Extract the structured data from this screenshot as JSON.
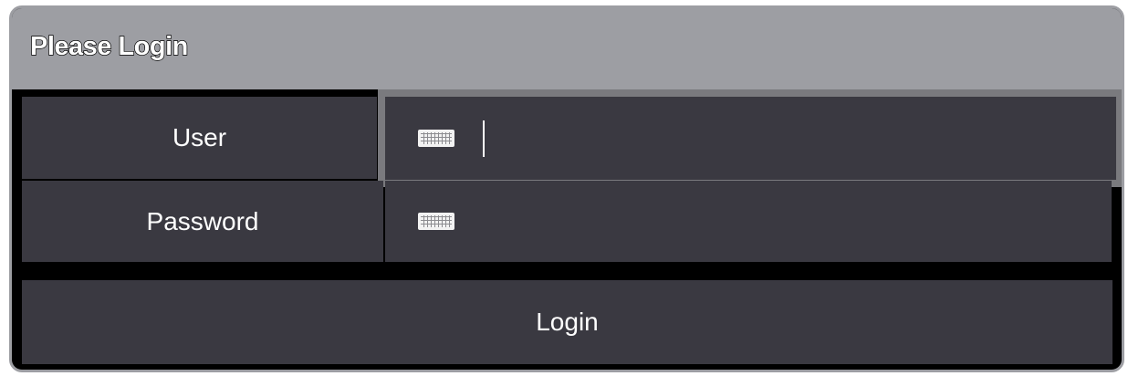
{
  "dialog": {
    "title": "Please Login"
  },
  "form": {
    "user_label": "User",
    "password_label": "Password",
    "user_value": "",
    "password_value": "",
    "user_icon": "keyboard-icon",
    "password_icon": "keyboard-icon"
  },
  "actions": {
    "login_label": "Login"
  },
  "colors": {
    "titlebar": "#9d9ea3",
    "cell": "#3a3941",
    "focus_border": "#7a7a7e",
    "background": "#000000",
    "text": "#ffffff"
  }
}
